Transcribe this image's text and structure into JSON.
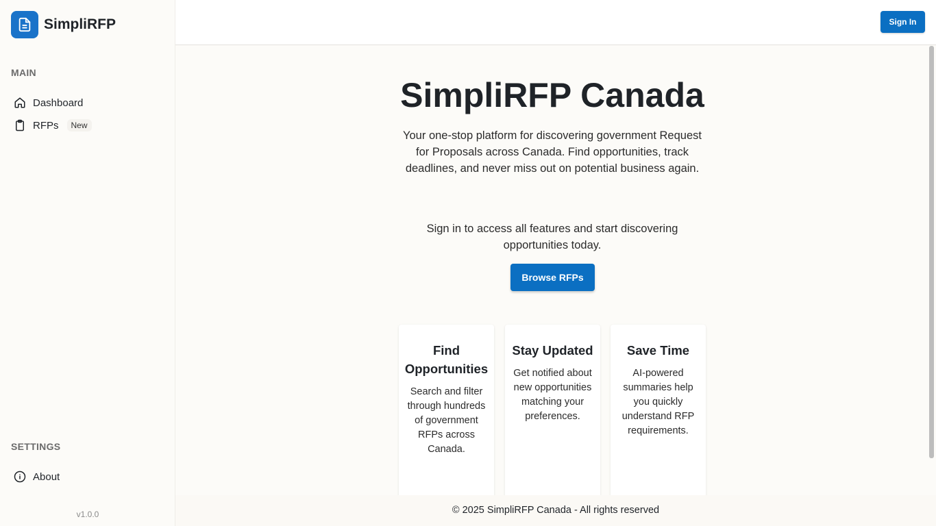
{
  "brand": {
    "name": "SimpliRFP"
  },
  "sidebar": {
    "main_label": "MAIN",
    "items": [
      {
        "label": "Dashboard",
        "icon": "home-icon"
      },
      {
        "label": "RFPs",
        "icon": "clipboard-icon",
        "badge": "New"
      }
    ],
    "settings_label": "SETTINGS",
    "settings_items": [
      {
        "label": "About",
        "icon": "info-icon"
      }
    ],
    "version": "v1.0.0"
  },
  "header": {
    "signin_label": "Sign In"
  },
  "hero": {
    "title": "SimpliRFP Canada",
    "description": "Your one-stop platform for discovering government Request for Proposals across Canada. Find opportunities, track deadlines, and never miss out on potential business again.",
    "signin_text": "Sign in to access all features and start discovering opportunities today.",
    "browse_label": "Browse RFPs"
  },
  "features": [
    {
      "title": "Find Opportunities",
      "body": "Search and filter through hundreds of government RFPs across Canada."
    },
    {
      "title": "Stay Updated",
      "body": "Get notified about new opportunities matching your preferences."
    },
    {
      "title": "Save Time",
      "body": "AI-powered summaries help you quickly understand RFP requirements."
    }
  ],
  "footer": {
    "text": "© 2025 SimpliRFP Canada - All rights reserved"
  },
  "colors": {
    "accent": "#0b6fc2",
    "background": "#fcfbf8"
  }
}
